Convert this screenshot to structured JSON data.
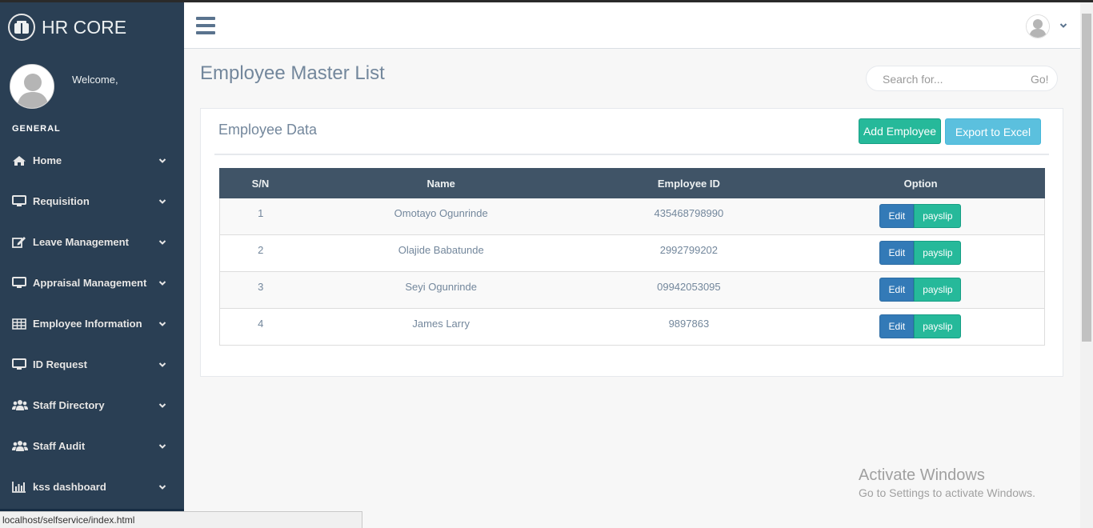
{
  "app": {
    "title": "HR CORE"
  },
  "sidebar": {
    "welcome": "Welcome,",
    "section_title": "GENERAL",
    "items": [
      {
        "label": "Home",
        "icon": "home-icon"
      },
      {
        "label": "Requisition",
        "icon": "desktop-icon"
      },
      {
        "label": "Leave Management",
        "icon": "edit-icon"
      },
      {
        "label": "Appraisal Management",
        "icon": "desktop-icon"
      },
      {
        "label": "Employee Information",
        "icon": "table-icon"
      },
      {
        "label": "ID Request",
        "icon": "desktop-icon"
      },
      {
        "label": "Staff Directory",
        "icon": "users-icon"
      },
      {
        "label": "Staff Audit",
        "icon": "users-icon"
      },
      {
        "label": "kss dashboard",
        "icon": "bar-chart-icon"
      }
    ]
  },
  "statusbar": {
    "url": "localhost/selfservice/index.html"
  },
  "main": {
    "page_title": "Employee Master List",
    "search": {
      "placeholder": "Search for...",
      "button": "Go!"
    },
    "panel": {
      "title": "Employee Data",
      "add_button": "Add Employee",
      "export_button": "Export to Excel",
      "columns": [
        "S/N",
        "Name",
        "Employee ID",
        "Option"
      ],
      "rows": [
        {
          "sn": "1",
          "name": "Omotayo Ogunrinde",
          "employee_id": "435468798990",
          "edit": "Edit",
          "payslip": "payslip"
        },
        {
          "sn": "2",
          "name": "Olajide Babatunde",
          "employee_id": "2992799202",
          "edit": "Edit",
          "payslip": "payslip"
        },
        {
          "sn": "3",
          "name": "Seyi Ogunrinde",
          "employee_id": "09942053095",
          "edit": "Edit",
          "payslip": "payslip"
        },
        {
          "sn": "4",
          "name": "James Larry",
          "employee_id": "9897863",
          "edit": "Edit",
          "payslip": "payslip"
        }
      ]
    }
  },
  "watermark": {
    "title": "Activate Windows",
    "subtitle": "Go to Settings to activate Windows."
  },
  "colors": {
    "sidebar": "#2a3f54",
    "table_header": "#405467",
    "success": "#26b99a",
    "info": "#5bc0de",
    "primary": "#337ab7"
  }
}
